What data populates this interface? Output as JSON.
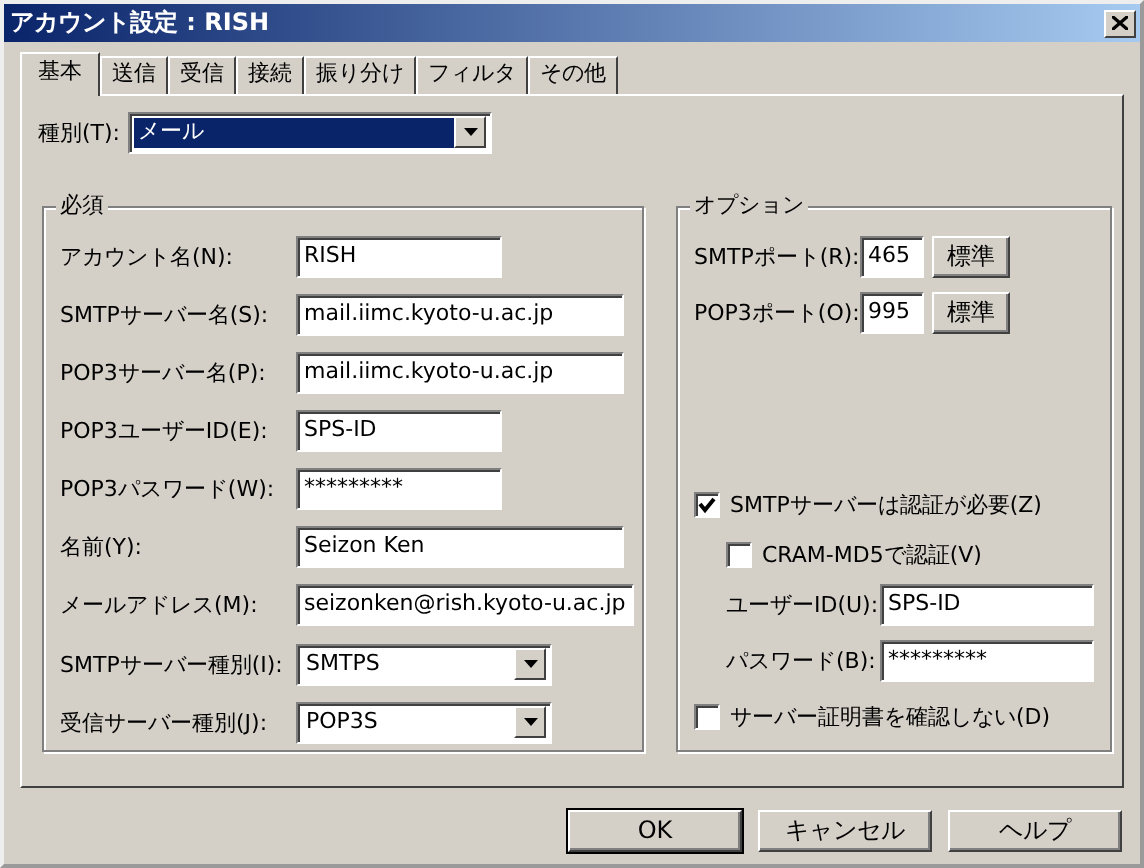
{
  "window": {
    "title": "アカウント設定 : RISH"
  },
  "tabs": [
    {
      "label": "基本",
      "selected": true
    },
    {
      "label": "送信",
      "selected": false
    },
    {
      "label": "受信",
      "selected": false
    },
    {
      "label": "接続",
      "selected": false
    },
    {
      "label": "振り分け",
      "selected": false
    },
    {
      "label": "フィルタ",
      "selected": false
    },
    {
      "label": "その他",
      "selected": false
    }
  ],
  "type_field": {
    "label": "種別(T):",
    "value": "メール",
    "focused": true
  },
  "required": {
    "title": "必須",
    "fields": [
      {
        "kind": "text",
        "label": "アカウント名(N):",
        "value": "RISH"
      },
      {
        "kind": "text",
        "label": "SMTPサーバー名(S):",
        "value": "mail.iimc.kyoto-u.ac.jp"
      },
      {
        "kind": "text",
        "label": "POP3サーバー名(P):",
        "value": "mail.iimc.kyoto-u.ac.jp"
      },
      {
        "kind": "text",
        "label": "POP3ユーザーID(E):",
        "value": "SPS-ID"
      },
      {
        "kind": "text",
        "label": "POP3パスワード(W):",
        "value": "*********"
      },
      {
        "kind": "text",
        "label": "名前(Y):",
        "value": "Seizon Ken"
      },
      {
        "kind": "text",
        "label": "メールアドレス(M):",
        "value": "seizonken@rish.kyoto-u.ac.jp"
      },
      {
        "kind": "dropdown",
        "label": "SMTPサーバー種別(I):",
        "value": "SMTPS"
      },
      {
        "kind": "dropdown",
        "label": "受信サーバー種別(J):",
        "value": "POP3S"
      }
    ]
  },
  "options": {
    "title": "オプション",
    "ports": [
      {
        "label": "SMTPポート(R):",
        "value": "465",
        "button": "標準"
      },
      {
        "label": "POP3ポート(O):",
        "value": "995",
        "button": "標準"
      }
    ],
    "items": [
      {
        "kind": "checkbox",
        "label": "SMTPサーバーは認証が必要(Z)",
        "checked": true,
        "children": [
          {
            "kind": "checkbox",
            "label": "CRAM-MD5で認証(V)",
            "checked": false
          },
          {
            "kind": "field",
            "label": "ユーザーID(U):",
            "value": "SPS-ID"
          },
          {
            "kind": "field",
            "label": "パスワード(B):",
            "value": "*********"
          }
        ]
      },
      {
        "kind": "checkbox",
        "label": "サーバー証明書を確認しない(D)",
        "checked": false
      }
    ]
  },
  "buttons": [
    {
      "label": "OK",
      "default": true
    },
    {
      "label": "キャンセル",
      "default": false
    },
    {
      "label": "ヘルプ",
      "default": false
    }
  ]
}
